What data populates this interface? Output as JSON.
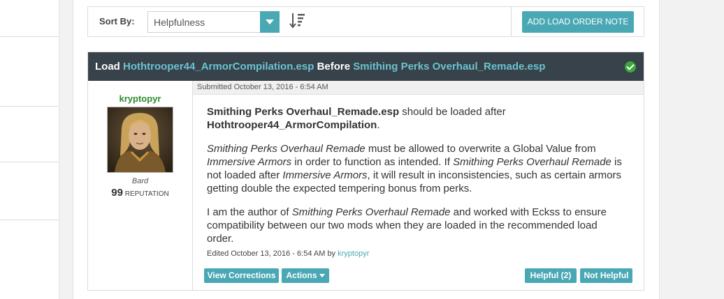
{
  "sortbar": {
    "sort_label": "Sort By:",
    "sort_value": "Helpfulness",
    "add_note_label": "ADD LOAD ORDER NOTE"
  },
  "note": {
    "header": {
      "load_word": "Load",
      "first_mod": "Hothtrooper44_ArmorCompilation.esp",
      "before_word": "Before",
      "second_mod": "Smithing Perks Overhaul_Remade.esp"
    },
    "user": {
      "name": "kryptopyr",
      "rank": "Bard",
      "reputation": "99",
      "reputation_label": "REPUTATION"
    },
    "submitted": "Submitted October 13, 2016 - 6:54 AM",
    "p1": {
      "mod_a": "Smithing Perks Overhaul_Remade.esp",
      "text_a": " should be loaded after",
      "mod_b": "Hothtrooper44_ArmorCompilation",
      "text_b": "."
    },
    "p2": {
      "t1": "Smithing Perks Overhaul Remade",
      "t2": " must be allowed to overwrite a Global Value from ",
      "t3": "Immersive Armors",
      "t4": " in order to function as intended. If ",
      "t5": "Smithing Perks Overhaul Remade",
      "t6": " is not loaded after ",
      "t7": "Immersive Armors",
      "t8": ", it will result in inconsistencies, such as certain armors getting double the expected tempering bonus from perks."
    },
    "p3": {
      "t1": "I am the author of ",
      "t2": "Smithing Perks Overhaul Remade",
      "t3": " and worked with Eckss to ensure compatibility between our two mods when they are loaded in the recommended load order."
    },
    "edited_prefix": "Edited October 13, 2016 - 6:54 AM by ",
    "edited_by": "kryptopyr",
    "buttons": {
      "view_corrections": "View Corrections",
      "actions": "Actions",
      "helpful": "Helpful (2)",
      "not_helpful": "Not Helpful"
    }
  },
  "colors": {
    "accent": "#4aa8b5",
    "header_bg": "#37424a",
    "header_link": "#6bc3d0",
    "username": "#2e8b2e",
    "check": "#3aaa3a"
  }
}
